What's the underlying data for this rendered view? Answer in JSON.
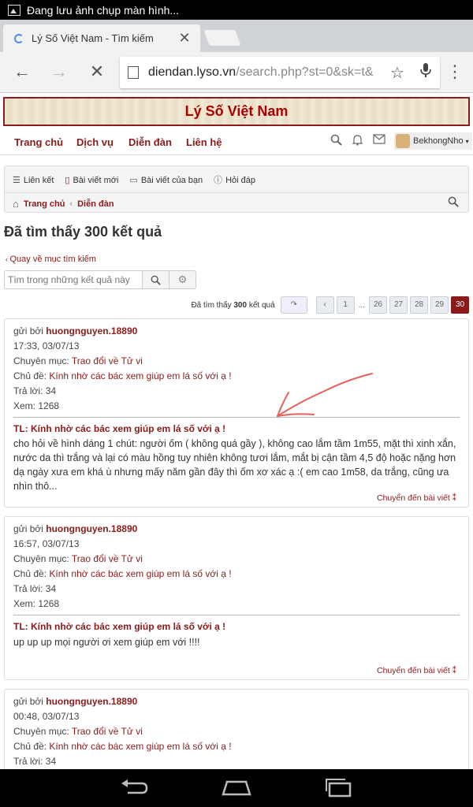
{
  "status_bar": {
    "notification": "Đang lưu ảnh chụp màn hình..."
  },
  "browser": {
    "tab_title": "Lý Số Việt Nam - Tìm kiếm",
    "url_host": "diendan.lyso.vn",
    "url_path": "/search.php?st=0&sk=t&"
  },
  "site": {
    "logo": "Lý Số Việt Nam",
    "nav": [
      "Trang chủ",
      "Dịch vụ",
      "Diễn đàn",
      "Liên hệ"
    ],
    "username": "BekhongNho"
  },
  "subnav": {
    "links": [
      "Liên kết",
      "Bài viết mới",
      "Bài viết của bạn",
      "Hỏi đáp"
    ],
    "breadcrumb": [
      "Trang chủ",
      "Diễn đàn"
    ]
  },
  "page": {
    "heading": "Đã tìm thấy 300 kết quả",
    "back_link": "Quay về mục tìm kiếm",
    "search_placeholder": "Tìm trong những kết quả này"
  },
  "pager": {
    "count_prefix": "Đã tìm thấy",
    "count": "300",
    "count_suffix": "kết quả",
    "pages": [
      "1",
      "26",
      "27",
      "28",
      "29",
      "30"
    ],
    "current": "30",
    "ellipsis": "..."
  },
  "labels": {
    "by": "gửi bởi",
    "forum": "Chuyên mục:",
    "topic": "Chủ đề:",
    "replies": "Trả lời:",
    "views": "Xem:",
    "jump": "Chuyển đến bài viết"
  },
  "results": [
    {
      "author": "huongnguyen.18890",
      "time": "17:33, 03/07/13",
      "forum": "Trao đổi về Tử vi",
      "topic": "Kính nhờ các bác xem giúp em lá số với ạ !",
      "replies": "34",
      "views": "1268",
      "post_title": "TL: Kính nhờ các bác xem giúp em lá số với ạ !",
      "snippet": "cho hỏi về hình dáng 1 chút: người ốm ( không quá gầy ), không cao lắm tầm 1m55, mặt thì xinh xắn, nước da thì trắng và lại có màu hồng tuy nhiên không tươi lắm, mắt bị cận tầm 4,5 độ hoặc nặng hơn dạ ngày xưa em khá ù nhưng mấy năm gần đây thì ốm xơ xác ạ :( em cao 1m58, da trắng, cũng ưa nhìn thô..."
    },
    {
      "author": "huongnguyen.18890",
      "time": "16:57, 03/07/13",
      "forum": "Trao đổi về Tử vi",
      "topic": "Kính nhờ các bác xem giúp em lá số với ạ !",
      "replies": "34",
      "views": "1268",
      "post_title": "TL: Kính nhờ các bác xem giúp em lá số với ạ !",
      "snippet": "up up up mọi người ơi xem giúp em với !!!!"
    },
    {
      "author": "huongnguyen.18890",
      "time": "00:48, 03/07/13",
      "forum": "Trao đổi về Tử vi",
      "topic": "Kính nhờ các bác xem giúp em lá số với ạ !",
      "replies": "34"
    }
  ],
  "colors": {
    "brand": "#8b1a1a",
    "annotation": "#e8605a"
  }
}
